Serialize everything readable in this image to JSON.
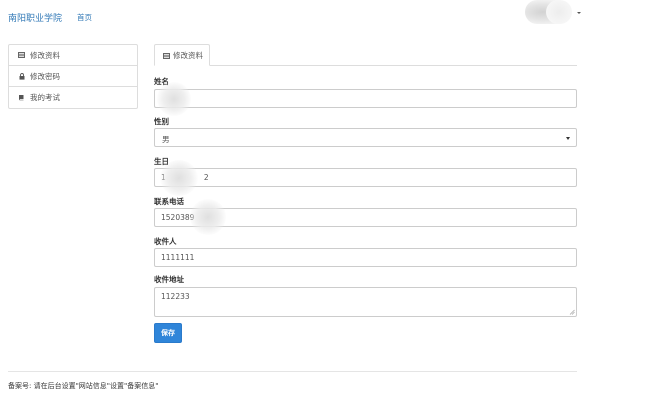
{
  "header": {
    "brand": "南阳职业学院",
    "nav_home": "首页",
    "user_icon": "avatar-blurred",
    "dropdown_icon": "caret-down-icon"
  },
  "sidebar": {
    "items": [
      {
        "label": "修改资料",
        "icon": "list-icon"
      },
      {
        "label": "修改密码",
        "icon": "lock-icon"
      },
      {
        "label": "我的考试",
        "icon": "book-icon"
      }
    ]
  },
  "tabs": [
    {
      "label": "修改资料",
      "icon": "list-icon",
      "active": true
    }
  ],
  "form": {
    "name": {
      "label": "姓名",
      "value": ""
    },
    "gender": {
      "label": "性别",
      "value": "男"
    },
    "birthday": {
      "label": "生日",
      "value": "1                2"
    },
    "phone": {
      "label": "联系电话",
      "value": "1520389"
    },
    "recipient": {
      "label": "收件人",
      "value": "1111111"
    },
    "address": {
      "label": "收件地址",
      "value": "112233"
    },
    "save_label": "保存"
  },
  "footer": {
    "text": "备案号: 请在后台设置\"网站信息\"设置\"备案信息\""
  },
  "colors": {
    "link": "#337ab7",
    "primary_button": "#2f85d9",
    "border": "#dddddd"
  }
}
